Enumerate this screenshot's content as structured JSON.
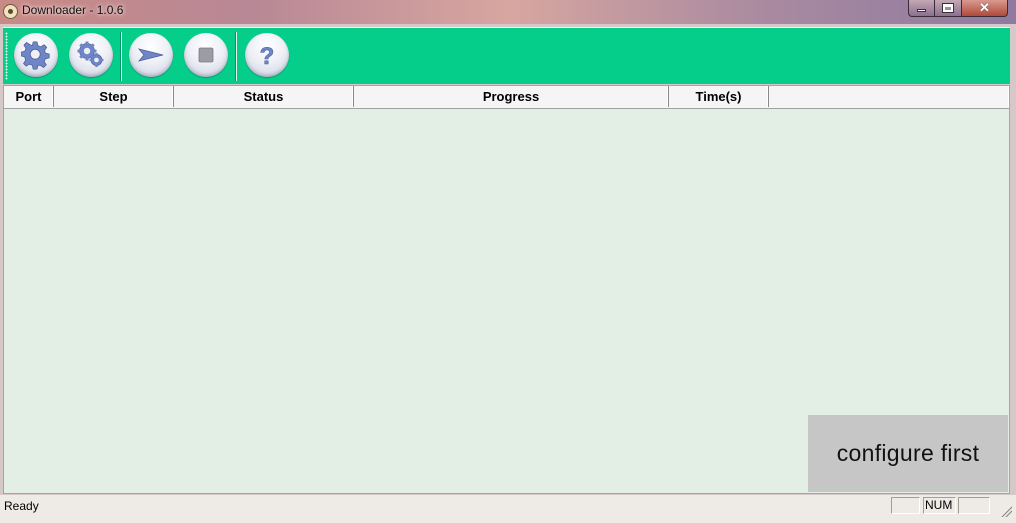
{
  "window": {
    "title": "Downloader - 1.0.6",
    "controls": {
      "minimize": "minimize",
      "maximize": "maximize",
      "close": "close"
    }
  },
  "toolbar": {
    "buttons": [
      {
        "name": "settings-button",
        "icon": "gear-icon"
      },
      {
        "name": "advanced-settings-button",
        "icon": "gears-icon"
      },
      {
        "name": "start-button",
        "icon": "arrow-right-icon"
      },
      {
        "name": "stop-button",
        "icon": "stop-icon"
      },
      {
        "name": "help-button",
        "icon": "question-icon"
      }
    ]
  },
  "list": {
    "columns": [
      "Port",
      "Step",
      "Status",
      "Progress",
      "Time(s)"
    ],
    "rows": []
  },
  "overlay": {
    "message": "configure first"
  },
  "statusbar": {
    "text": "Ready",
    "panes": [
      "",
      "NUM",
      ""
    ]
  },
  "colors": {
    "toolbar": "#05ce8a",
    "list_background": "#e3eee5",
    "overlay": "#c6c6c6"
  }
}
